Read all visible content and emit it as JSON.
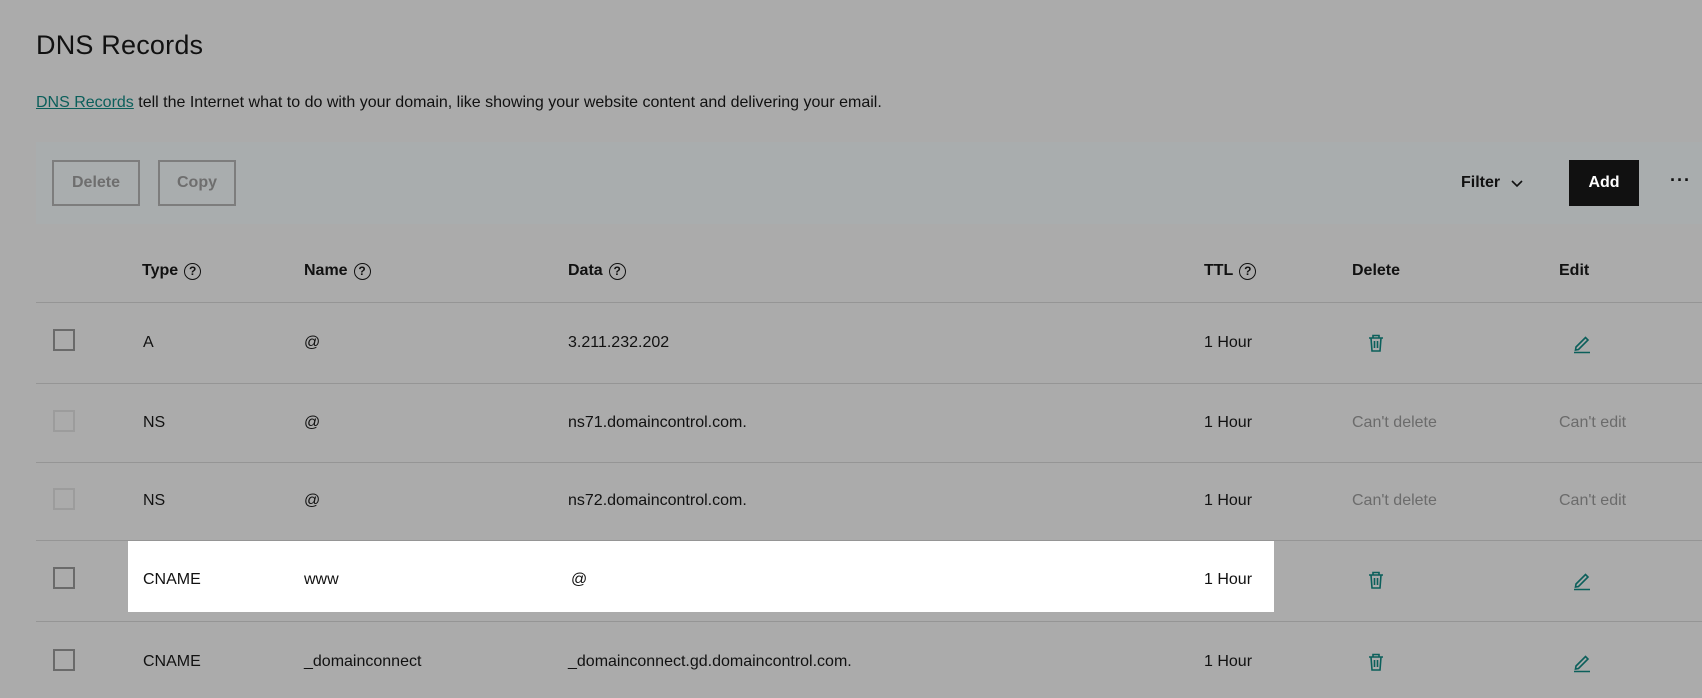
{
  "page": {
    "title": "DNS Records",
    "intro_link": "DNS Records",
    "intro_text": " tell the Internet what to do with your domain, like showing your website content and delivering your email."
  },
  "toolbar": {
    "delete_label": "Delete",
    "copy_label": "Copy",
    "filter_label": "Filter",
    "add_label": "Add",
    "more_label": "···"
  },
  "table": {
    "headers": {
      "type": "Type",
      "name": "Name",
      "data": "Data",
      "ttl": "TTL",
      "delete": "Delete",
      "edit": "Edit"
    },
    "help_glyph": "?",
    "rows": [
      {
        "type": "A",
        "name": "@",
        "data": "3.211.232.202",
        "ttl": "1 Hour",
        "delete": "",
        "edit": ""
      },
      {
        "type": "NS",
        "name": "@",
        "data": "ns71.domaincontrol.com.",
        "ttl": "1 Hour",
        "delete": "Can't delete",
        "edit": "Can't edit"
      },
      {
        "type": "NS",
        "name": "@",
        "data": "ns72.domaincontrol.com.",
        "ttl": "1 Hour",
        "delete": "Can't delete",
        "edit": "Can't edit"
      },
      {
        "type": "CNAME",
        "name": "www",
        "data": "@",
        "ttl": "1 Hour",
        "delete": "",
        "edit": ""
      },
      {
        "type": "CNAME",
        "name": "_domainconnect",
        "data": "_domainconnect.gd.domaincontrol.com.",
        "ttl": "1 Hour",
        "delete": "",
        "edit": ""
      }
    ]
  },
  "icons": {
    "delete": "trash-icon",
    "edit": "pencil-icon",
    "help": "help-circle-icon",
    "filter": "chevron-down-icon"
  },
  "colors": {
    "accent": "#0b5f5b",
    "add_button": "#111111",
    "highlight_row": "#ffffff"
  }
}
